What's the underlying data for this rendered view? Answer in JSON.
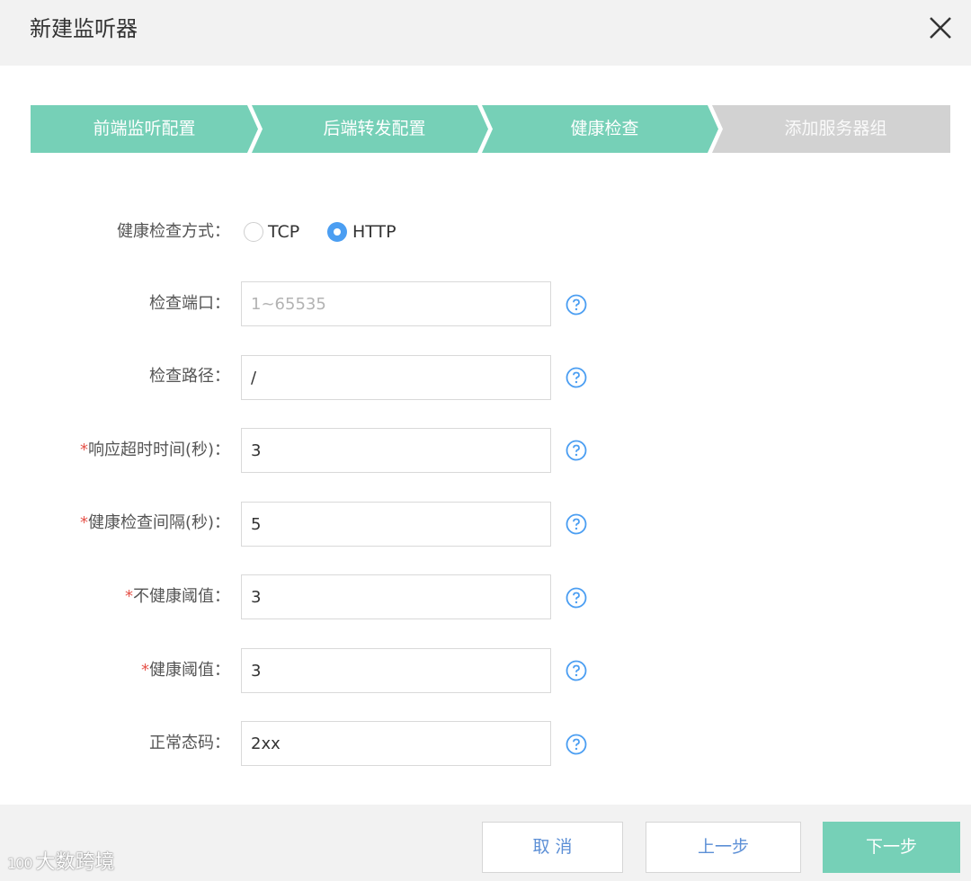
{
  "dialog": {
    "title": "新建监听器",
    "close_icon": "close-icon"
  },
  "steps": [
    {
      "label": "前端监听配置",
      "state": "done"
    },
    {
      "label": "后端转发配置",
      "state": "done"
    },
    {
      "label": "健康检查",
      "state": "active"
    },
    {
      "label": "添加服务器组",
      "state": "pending"
    }
  ],
  "colors": {
    "step_active": "#76d0b7",
    "step_pending": "#d2d2d2",
    "radio_selected": "#4b9ef2",
    "required_star": "#e6534a",
    "help_icon": "#4b9ef2"
  },
  "form": {
    "method": {
      "label": "健康检查方式：",
      "options": [
        "TCP",
        "HTTP"
      ],
      "selected": "HTTP"
    },
    "port": {
      "label": "检查端口：",
      "value": "",
      "placeholder": "1~65535",
      "required": false
    },
    "path": {
      "label": "检查路径：",
      "value": "/",
      "required": false
    },
    "timeout": {
      "label": "响应超时时间(秒)：",
      "value": "3",
      "required": true
    },
    "interval": {
      "label": "健康检查间隔(秒)：",
      "value": "5",
      "required": true
    },
    "unhealthy": {
      "label": "不健康阈值：",
      "value": "3",
      "required": true
    },
    "healthy": {
      "label": "健康阈值：",
      "value": "3",
      "required": true
    },
    "status_code": {
      "label": "正常态码：",
      "value": "2xx",
      "required": false
    }
  },
  "footer": {
    "cancel": "取 消",
    "prev": "上一步",
    "next": "下一步"
  },
  "watermark": {
    "logo": "100",
    "text": "大数跨境"
  }
}
